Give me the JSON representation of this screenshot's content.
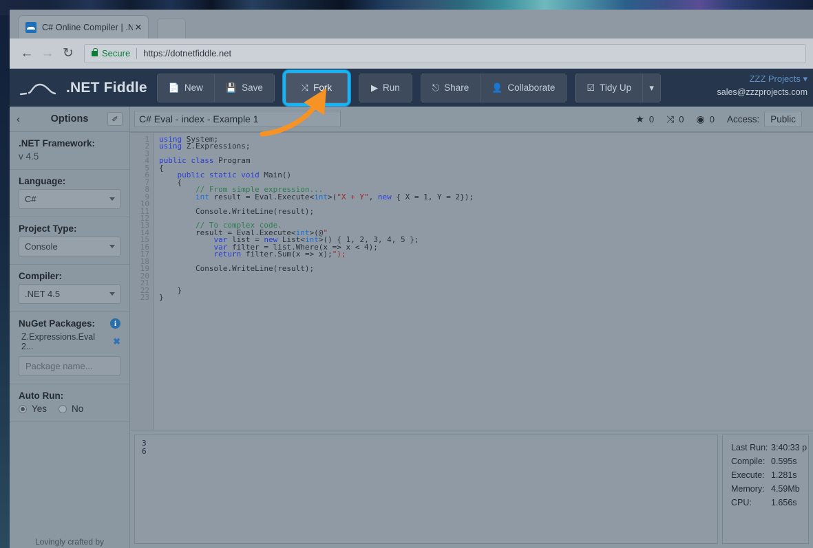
{
  "browser": {
    "tab": {
      "title": "C# Online Compiler | .NE",
      "close_label": "✕",
      "favicon": "dotnetfiddle-favicon"
    },
    "nav": {
      "back": "←",
      "forward": "→",
      "reload": "↻"
    },
    "omnibox": {
      "secure_label": "Secure",
      "url": "https://dotnetfiddle.net"
    }
  },
  "navbar": {
    "brand": ".NET Fiddle",
    "buttons": [
      {
        "id": "new",
        "label": "New",
        "icon": "📄"
      },
      {
        "id": "save",
        "label": "Save",
        "icon": "💾"
      },
      {
        "id": "fork",
        "label": "Fork",
        "icon": "⤨"
      },
      {
        "id": "run",
        "label": "Run",
        "icon": "▶"
      },
      {
        "id": "share",
        "label": "Share",
        "icon": "⎋"
      },
      {
        "id": "collaborate",
        "label": "Collaborate",
        "icon": "👤"
      },
      {
        "id": "tidyup",
        "label": "Tidy Up",
        "icon": "☑"
      }
    ],
    "dropdown_caret": "▾",
    "user_name": "ZZZ Projects",
    "user_caret": "▾",
    "user_email": "sales@zzzprojects.com",
    "highlight_color": "#17b4f5",
    "arrow_color": "#f79225"
  },
  "sidebar": {
    "back_icon": "‹",
    "title": "Options",
    "pin_icon": "✐",
    "sections": [
      {
        "label": ".NET Framework:",
        "type": "text",
        "value": "v 4.5"
      },
      {
        "label": "Language:",
        "type": "select",
        "value": "C#"
      },
      {
        "label": "Project Type:",
        "type": "select",
        "value": "Console"
      },
      {
        "label": "Compiler:",
        "type": "select",
        "value": ".NET 4.5"
      }
    ],
    "nuget": {
      "label": "NuGet Packages:",
      "info_icon": "i",
      "package": "Z.Expressions.Eval 2...",
      "remove_icon": "✖",
      "placeholder": "Package name..."
    },
    "autorun": {
      "label": "Auto Run:",
      "options": [
        {
          "label": "Yes",
          "selected": true
        },
        {
          "label": "No",
          "selected": false
        }
      ]
    },
    "footer": "Lovingly crafted by"
  },
  "fiddle": {
    "title_value": "C# Eval - index - Example 1",
    "stats": [
      {
        "icon": "★",
        "name": "star-icon",
        "count": "0"
      },
      {
        "icon": "⤨",
        "name": "fork-icon",
        "count": "0"
      },
      {
        "icon": "◉",
        "name": "eye-icon",
        "count": "0"
      }
    ],
    "access_label": "Access:",
    "access_value": "Public"
  },
  "code": {
    "line_count": 23,
    "lines": [
      "using System;",
      "using Z.Expressions;",
      "",
      "public class Program",
      "{",
      "    public static void Main()",
      "    {",
      "        // From simple expression...",
      "        int result = Eval.Execute<int>(\"X + Y\", new { X = 1, Y = 2});",
      "",
      "        Console.WriteLine(result);",
      "",
      "        // To complex code.",
      "        result = Eval.Execute<int>(@\"",
      "            var list = new List<int>() { 1, 2, 3, 4, 5 };",
      "            var filter = list.Where(x => x < 4);",
      "            return filter.Sum(x => x);\");",
      "",
      "        Console.WriteLine(result);",
      "",
      "",
      "    }",
      "}"
    ]
  },
  "output": {
    "console_text": "3\n6",
    "stats": [
      {
        "label": "Last Run:",
        "value": "3:40:33 p"
      },
      {
        "label": "Compile:",
        "value": "0.595s"
      },
      {
        "label": "Execute:",
        "value": "1.281s"
      },
      {
        "label": "Memory:",
        "value": "4.59Mb"
      },
      {
        "label": "CPU:",
        "value": "1.656s"
      }
    ]
  }
}
